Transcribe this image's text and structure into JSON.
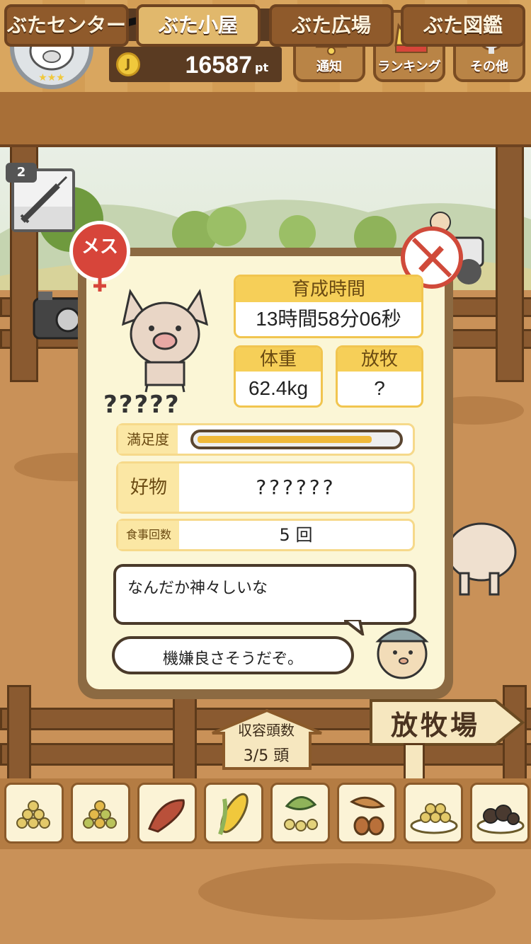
{
  "header": {
    "points_value": "16587",
    "points_unit": "pt",
    "coin_icon": "coin-icon",
    "buttons": [
      {
        "label": "通知",
        "icon": "bell-icon"
      },
      {
        "label": "ランキング",
        "icon": "crown-icon"
      },
      {
        "label": "その他",
        "icon": "gear-icon"
      }
    ]
  },
  "nav": {
    "tabs": [
      {
        "label": "ぶたセンター",
        "active": false
      },
      {
        "label": "ぶた小屋",
        "active": true
      },
      {
        "label": "ぶた広場",
        "active": false
      },
      {
        "label": "ぶた図鑑",
        "active": false
      }
    ]
  },
  "item": {
    "count": "2",
    "icon": "syringe-icon"
  },
  "pig": {
    "sex_badge": "メス",
    "name": "?????",
    "growth_time_label": "育成時間",
    "growth_time_value": "13時間58分06秒",
    "weight_label": "体重",
    "weight_value": "62.4kg",
    "grazing_label": "放牧",
    "grazing_value": "?",
    "satisfaction_label": "満足度",
    "satisfaction_fraction": 0.88,
    "favorite_label": "好物",
    "favorite_value": "??????",
    "meal_count_label": "食事回数",
    "meal_count_value": "5 回"
  },
  "dialog": {
    "line1": "なんだか神々しいな",
    "line2": "機嫌良さそうだぞ。"
  },
  "capacity": {
    "label": "収容頭数",
    "value": "3/5 頭"
  },
  "pasture_sign": "放牧場",
  "colors": {
    "accent": "#f6cf58",
    "female": "#d7453a",
    "wood": "#8a5a30"
  }
}
